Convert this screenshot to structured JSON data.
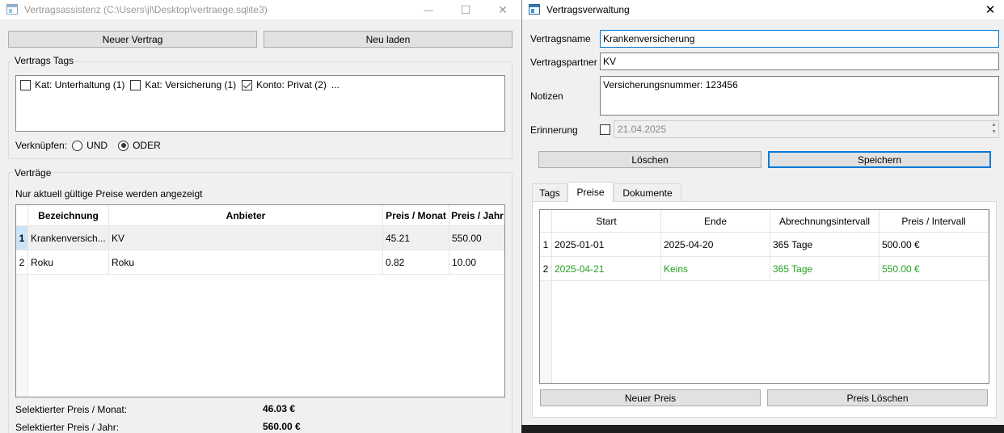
{
  "main_window": {
    "title": "Vertragsassistenz (C:\\Users\\jl\\Desktop\\vertraege.sqlite3)",
    "minimize_glyph": "—",
    "maximize_glyph": "☐",
    "close_glyph": "✕",
    "new_contract_label": "Neuer Vertrag",
    "reload_label": "Neu laden",
    "tags_group_label": "Vertrags Tags",
    "tags": [
      {
        "label": "Kat: Unterhaltung (1)",
        "checked": false
      },
      {
        "label": "Kat: Versicherung (1)",
        "checked": false
      },
      {
        "label": "Konto: Privat (2)",
        "checked": true
      }
    ],
    "tags_more": "...",
    "link_label": "Verknüpfen:",
    "link_options": [
      {
        "label": "UND",
        "selected": false
      },
      {
        "label": "ODER",
        "selected": true
      }
    ],
    "contracts_group_label": "Verträge",
    "contracts_note": "Nur aktuell gültige Preise werden angezeigt",
    "table_headers": [
      "Bezeichnung",
      "Anbieter",
      "Preis / Monat",
      "Preis / Jahr"
    ],
    "rows": [
      {
        "num": "1",
        "name": "Krankenversich...",
        "provider": "KV",
        "month": "45.21",
        "year": "550.00"
      },
      {
        "num": "2",
        "name": "Roku",
        "provider": "Roku",
        "month": "0.82",
        "year": "10.00"
      }
    ],
    "sel_month_label": "Selektierter Preis / Monat:",
    "sel_month_value": "46.03 €",
    "sel_year_label": "Selektierter Preis / Jahr:",
    "sel_year_value": "560.00 €"
  },
  "detail_window": {
    "title": "Vertragsverwaltung",
    "close_glyph": "✕",
    "name_label": "Vertragsname",
    "name_value": "Krankenversicherung",
    "partner_label": "Vertragspartner",
    "partner_value": "KV",
    "notes_label": "Notizen",
    "notes_value": "Versicherungsnummer: 123456",
    "reminder_label": "Erinnerung",
    "reminder_checked": false,
    "reminder_date": "21.04.2025",
    "delete_label": "Löschen",
    "save_label": "Speichern",
    "tabs": [
      {
        "label": "Tags",
        "active": false
      },
      {
        "label": "Preise",
        "active": true
      },
      {
        "label": "Dokumente",
        "active": false
      }
    ],
    "price_headers": [
      "Start",
      "Ende",
      "Abrechnungsintervall",
      "Preis / Intervall"
    ],
    "price_rows": [
      {
        "num": "1",
        "start": "2025-01-01",
        "end": "2025-04-20",
        "interval": "365 Tage",
        "price": "500.00 €",
        "current": false
      },
      {
        "num": "2",
        "start": "2025-04-21",
        "end": "Keins",
        "interval": "365 Tage",
        "price": "550.00 €",
        "current": true
      }
    ],
    "new_price_label": "Neuer Preis",
    "delete_price_label": "Preis Löschen"
  },
  "colors": {
    "current_price": "#22a022",
    "accent": "#0078d7"
  }
}
